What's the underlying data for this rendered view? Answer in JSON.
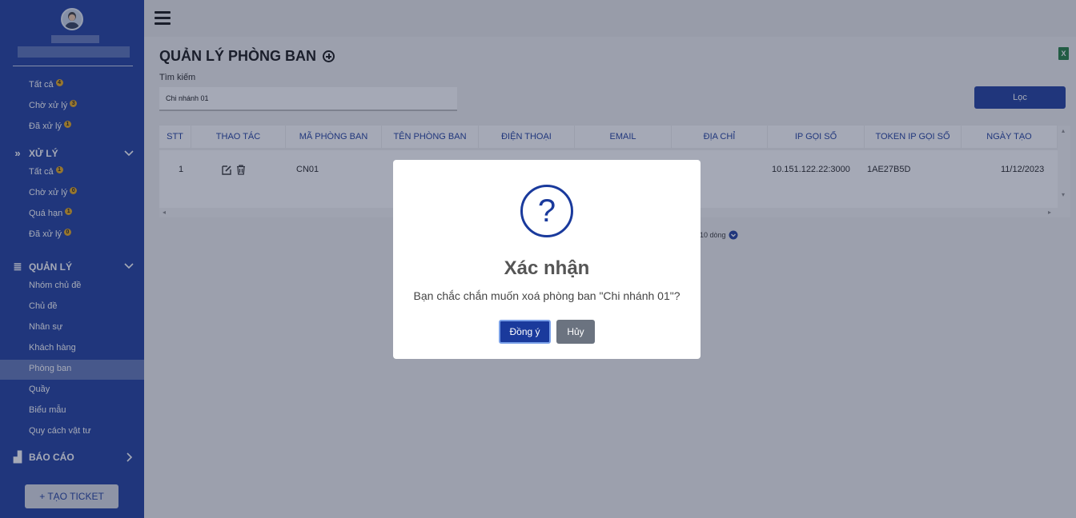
{
  "sidebar": {
    "group1": [
      {
        "label": "Tất cả",
        "badge": "4"
      },
      {
        "label": "Chờ xử lý",
        "badge": "3"
      },
      {
        "label": "Đã xử lý",
        "badge": "1"
      }
    ],
    "xuly_title": "XỬ LÝ",
    "xuly_items": [
      {
        "label": "Tất cả",
        "badge": "1"
      },
      {
        "label": "Chờ xử lý",
        "badge": "0"
      },
      {
        "label": "Quá hạn",
        "badge": "1"
      },
      {
        "label": "Đã xử lý",
        "badge": "0"
      }
    ],
    "quanly_title": "QUẢN LÝ",
    "quanly_items": [
      "Nhóm chủ đề",
      "Chủ đề",
      "Nhân sự",
      "Khách hàng",
      "Phòng ban",
      "Quầy",
      "Biểu mẫu",
      "Quy cách vật tư"
    ],
    "baocao_title": "BÁO CÁO",
    "ticket_button": "+ TẠO TICKET"
  },
  "main": {
    "title": "QUẢN LÝ PHÒNG BAN",
    "search_label": "Tìm kiếm",
    "search_value": "Chi nhánh 01",
    "filter_button": "Lọc",
    "columns": [
      "STT",
      "THAO TÁC",
      "MÃ PHÒNG BAN",
      "TÊN PHÒNG BAN",
      "ĐIỆN THOẠI",
      "EMAIL",
      "ĐỊA CHỈ",
      "IP GỌI SỐ",
      "TOKEN IP GỌI SỐ",
      "NGÀY TẠO"
    ],
    "row": {
      "stt": "1",
      "ma": "CN01",
      "ip": "10.151.122.22:3000",
      "token": "1AE27B5D",
      "ngay_tao": "11/12/2023"
    },
    "pager_text": "10 dòng"
  },
  "dialog": {
    "icon": "?",
    "title": "Xác nhận",
    "message": "Bạn chắc chắn muốn xoá phòng ban \"Chi nhánh 01\"?",
    "ok": "Đồng ý",
    "cancel": "Hủy"
  },
  "colors": {
    "primary": "#1a3a9c",
    "badge": "#e6a817",
    "cancel": "#6b7380"
  }
}
